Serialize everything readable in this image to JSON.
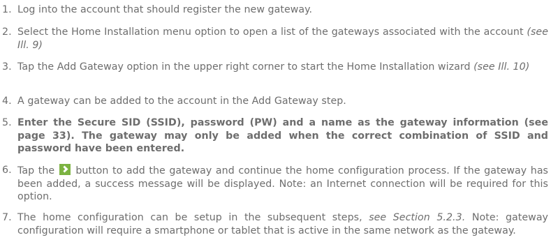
{
  "steps": [
    {
      "num": "1.",
      "text": "Log into the account that should register the new gateway."
    },
    {
      "num": "2.",
      "text": "Select the Home Installation menu option to open a list of the gateways associated with the account",
      "ref": "(see Ill. 9)"
    },
    {
      "num": "3.",
      "text": "Tap the Add Gateway option in the upper right corner to start the Home Installation wizard",
      "ref": "(see Ill. 10)"
    },
    {
      "num": "4.",
      "text": "A gateway can be added to the account in the Add Gateway step."
    },
    {
      "num": "5.",
      "text": "Enter the Secure SID (SSID), password (PW) and a name as the gateway information (see page 33). The gateway may only be added when the correct combination of SSID and password have been entered."
    },
    {
      "num": "6.",
      "text_before_icon": "Tap the",
      "icon": "green-play-arrow-icon",
      "text_after_icon": "button to add the gateway and continue the home configuration process. If the gateway has been added, a success message will be displayed. Note: an Internet connection will be required for this option."
    },
    {
      "num": "7.",
      "text_before_ref": "The home configuration can be setup in the subsequent steps,",
      "ref": "see Section 5.2.3.",
      "text_after_ref": "Note: gateway configuration will require a smartphone or tablet that is active in the same network as the gateway."
    }
  ]
}
